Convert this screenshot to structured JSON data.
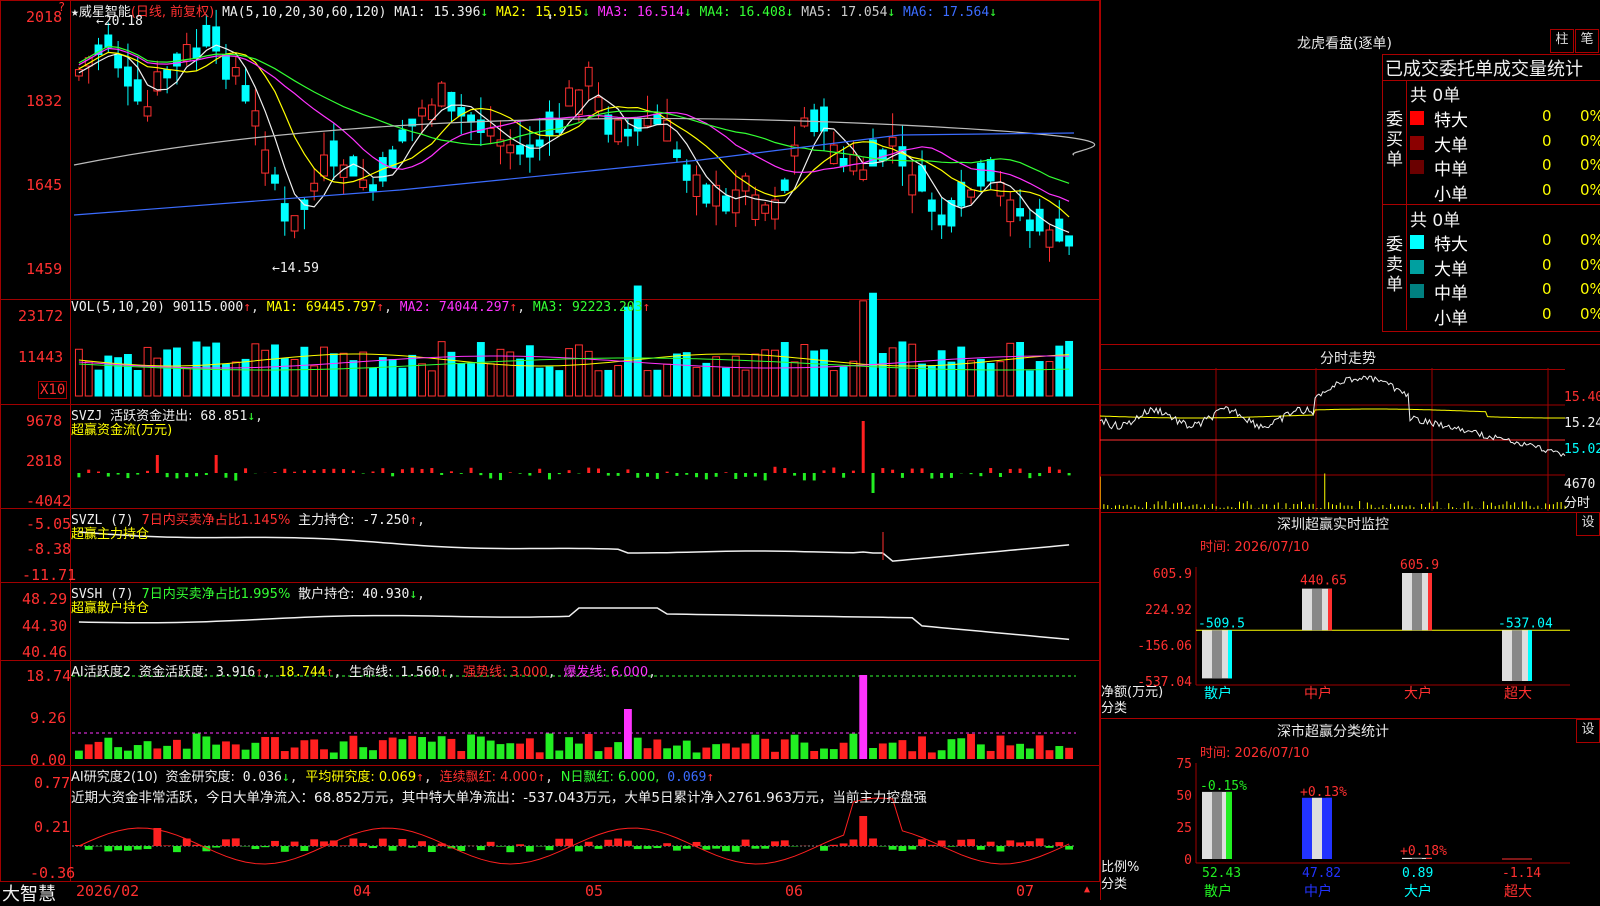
{
  "brand": "大智慧",
  "header": {
    "star": "★",
    "stock_name": "威星智能",
    "period": "(日线, 前复权)",
    "ma_params": "MA(5,10,20,30,60,120)",
    "ma": [
      {
        "label": "MA1:",
        "value": "15.396",
        "arrow": "↓",
        "color": "#f0f0f0"
      },
      {
        "label": "MA2:",
        "value": "15.915",
        "arrow": "↓",
        "color": "#ffff00"
      },
      {
        "label": "MA3:",
        "value": "16.514",
        "arrow": "↓",
        "color": "#ff33ff"
      },
      {
        "label": "MA4:",
        "value": "16.408",
        "arrow": "↓",
        "color": "#33ff33"
      },
      {
        "label": "MA5:",
        "value": "17.054",
        "arrow": "↓",
        "color": "#cccccc"
      },
      {
        "label": "MA6:",
        "value": "17.564",
        "arrow": "↓",
        "color": "#3b6cff"
      }
    ],
    "hi_mark": "20.18",
    "lo_mark": "14.59"
  },
  "price_axis": [
    "2018",
    "1832",
    "1645",
    "1459"
  ],
  "vol": {
    "label": "VOL(5,10,20)",
    "value": "90115.000",
    "ma": [
      {
        "label": "MA1:",
        "value": "69445.797",
        "color": "#ffff00"
      },
      {
        "label": "MA2:",
        "value": "74044.297",
        "color": "#ff33ff"
      },
      {
        "label": "MA3:",
        "value": "92223.203",
        "color": "#33ff33"
      }
    ],
    "axis": [
      "23172",
      "11443"
    ],
    "unit": "X10"
  },
  "svzj": {
    "label": "SVZJ",
    "desc": "活跃资金进出:",
    "value": "68.851",
    "sub": "超赢资金流(万元)",
    "axis": [
      "9678",
      "2818",
      "-4042"
    ]
  },
  "svzl": {
    "label": "SVZL (7)",
    "desc": "7日内买卖净占比1.145%",
    "desc2": "主力持仓:",
    "value": "-7.250",
    "sub": "超赢主力持仓",
    "axis": [
      "-5.05",
      "-8.38",
      "-11.71"
    ]
  },
  "svsh": {
    "label": "SVSH (7)",
    "desc": "7日内买卖净占比1.995%",
    "desc2": "散户持仓:",
    "value": "40.930",
    "sub": "超赢散户持仓",
    "axis": [
      "48.29",
      "44.30",
      "40.46"
    ]
  },
  "ai1": {
    "label": "AI活跃度2",
    "desc": "资金活跃度:",
    "v1": "3.916",
    "v2": "18.744",
    "desc2": "生命线:",
    "v3": "1.560",
    "strong": "强势线: 3.000",
    "burst": "爆发线: 6.000",
    "axis": [
      "18.74",
      "9.26",
      "0.00"
    ]
  },
  "ai2": {
    "label": "AI研究度2(10)",
    "desc": "资金研究度:",
    "v1": "0.036",
    "avg": "平均研究度: 0.069",
    "lx": "连续飘红: 4.000",
    "nr": "N日飘红: 6.000,",
    "v5": "0.069",
    "note": "近期大资金非常活跃，今日大单净流入：68.852万元，其中特大单净流出：-537.043万元，大单5日累计净入2761.963万元，当前主力控盘强",
    "axis": [
      "0.77",
      "0.21",
      "-0.36"
    ]
  },
  "xaxis": [
    "2026/02",
    "04",
    "05",
    "06",
    "07"
  ],
  "right": {
    "lhkp_title": "龙虎看盘(逐单)",
    "btn_zhu": "柱",
    "btn_bi": "笔",
    "order_title": "已成交委托单成交量统计",
    "buy_side": "委买单",
    "sell_side": "委卖单",
    "buy_total": "共 0单",
    "sell_total": "共 0单",
    "buy_rows": [
      {
        "name": "特大",
        "count": "0",
        "pct": "0%",
        "color": "#ff0000"
      },
      {
        "name": "大单",
        "count": "0",
        "pct": "0%",
        "color": "#8b0000"
      },
      {
        "name": "中单",
        "count": "0",
        "pct": "0%",
        "color": "#6a0000"
      },
      {
        "name": "小单",
        "count": "0",
        "pct": "0%",
        "color": ""
      }
    ],
    "sell_rows": [
      {
        "name": "特大",
        "count": "0",
        "pct": "0%",
        "color": "#00ffff"
      },
      {
        "name": "大单",
        "count": "0",
        "pct": "0%",
        "color": "#00a0a0"
      },
      {
        "name": "中单",
        "count": "0",
        "pct": "0%",
        "color": "#008080"
      },
      {
        "name": "小单",
        "count": "0",
        "pct": "0%",
        "color": ""
      }
    ],
    "fs_title": "分时走势",
    "fs_axis": [
      "15.40",
      "15.24",
      "15.02"
    ],
    "fs_vol": "4670",
    "fs_vol_label": "分时",
    "sz_title": "深圳超赢实时监控",
    "btn_set": "设",
    "sz_time": "时间: 2026/07/10",
    "sz_axis": [
      "605.9",
      "224.92",
      "-156.06",
      "-537.04"
    ],
    "sz_ylabel": "净额(万元)",
    "sz_xlabel": "分类",
    "sz_cats": [
      "散户",
      "中户",
      "大户",
      "超大"
    ],
    "sz_vals": [
      "-509.5",
      "440.65",
      "605.9",
      "-537.04"
    ],
    "fl_title": "深市超赢分类统计",
    "fl_time": "时间: 2026/07/10",
    "fl_axis": [
      "75",
      "50",
      "25",
      "0"
    ],
    "fl_ylabel": "比例%",
    "fl_xlabel": "分类",
    "fl_cats": [
      "散户",
      "中户",
      "大户",
      "超大"
    ],
    "fl_vals": [
      "52.43",
      "47.82",
      "0.89",
      "-1.14"
    ],
    "fl_chg": [
      "-0.15%",
      "+0.13%",
      "+0.18%",
      ""
    ]
  },
  "chart_data": [
    {
      "type": "bar",
      "title": "深圳超赢实时监控",
      "ylabel": "净额(万元)",
      "categories": [
        "散户",
        "中户",
        "大户",
        "超大"
      ],
      "values": [
        -509.5,
        440.65,
        605.9,
        -537.04
      ],
      "ylim": [
        -537.04,
        605.9
      ]
    },
    {
      "type": "bar",
      "title": "深市超赢分类统计",
      "ylabel": "比例%",
      "categories": [
        "散户",
        "中户",
        "大户",
        "超大"
      ],
      "values": [
        52.43,
        47.82,
        0.89,
        -1.14
      ],
      "ylim": [
        0,
        75
      ]
    }
  ]
}
